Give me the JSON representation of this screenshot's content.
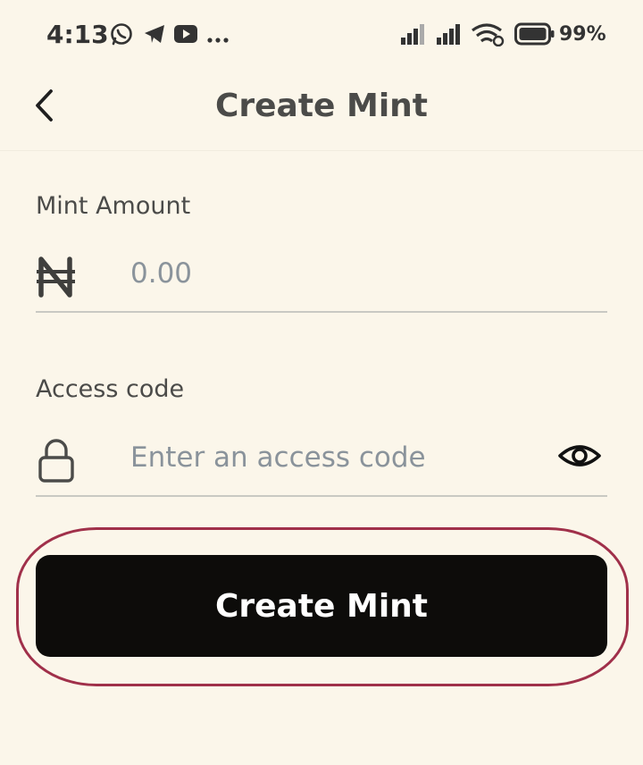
{
  "status_bar": {
    "time": "4:13",
    "notification_icons": [
      "whatsapp-icon",
      "telegram-icon",
      "youtube-icon",
      "more-dots-icon"
    ],
    "system_icons": [
      "signal-icon",
      "signal-icon",
      "wifi-icon",
      "battery-icon"
    ],
    "battery": "99%"
  },
  "header": {
    "title": "Create Mint",
    "back_icon": "chevron-left-icon"
  },
  "form": {
    "amount_label": "Mint Amount",
    "currency_symbol": "₦",
    "amount_placeholder": "0.00",
    "access_label": "Access code",
    "access_placeholder": "Enter an access code",
    "lock_icon": "lock-icon",
    "visibility_icon": "eye-icon"
  },
  "actions": {
    "create_label": "Create Mint"
  },
  "colors": {
    "background": "#fbf6ea",
    "button": "#0d0c0a",
    "highlight_outline": "#a0304a",
    "placeholder": "#8a939b"
  }
}
